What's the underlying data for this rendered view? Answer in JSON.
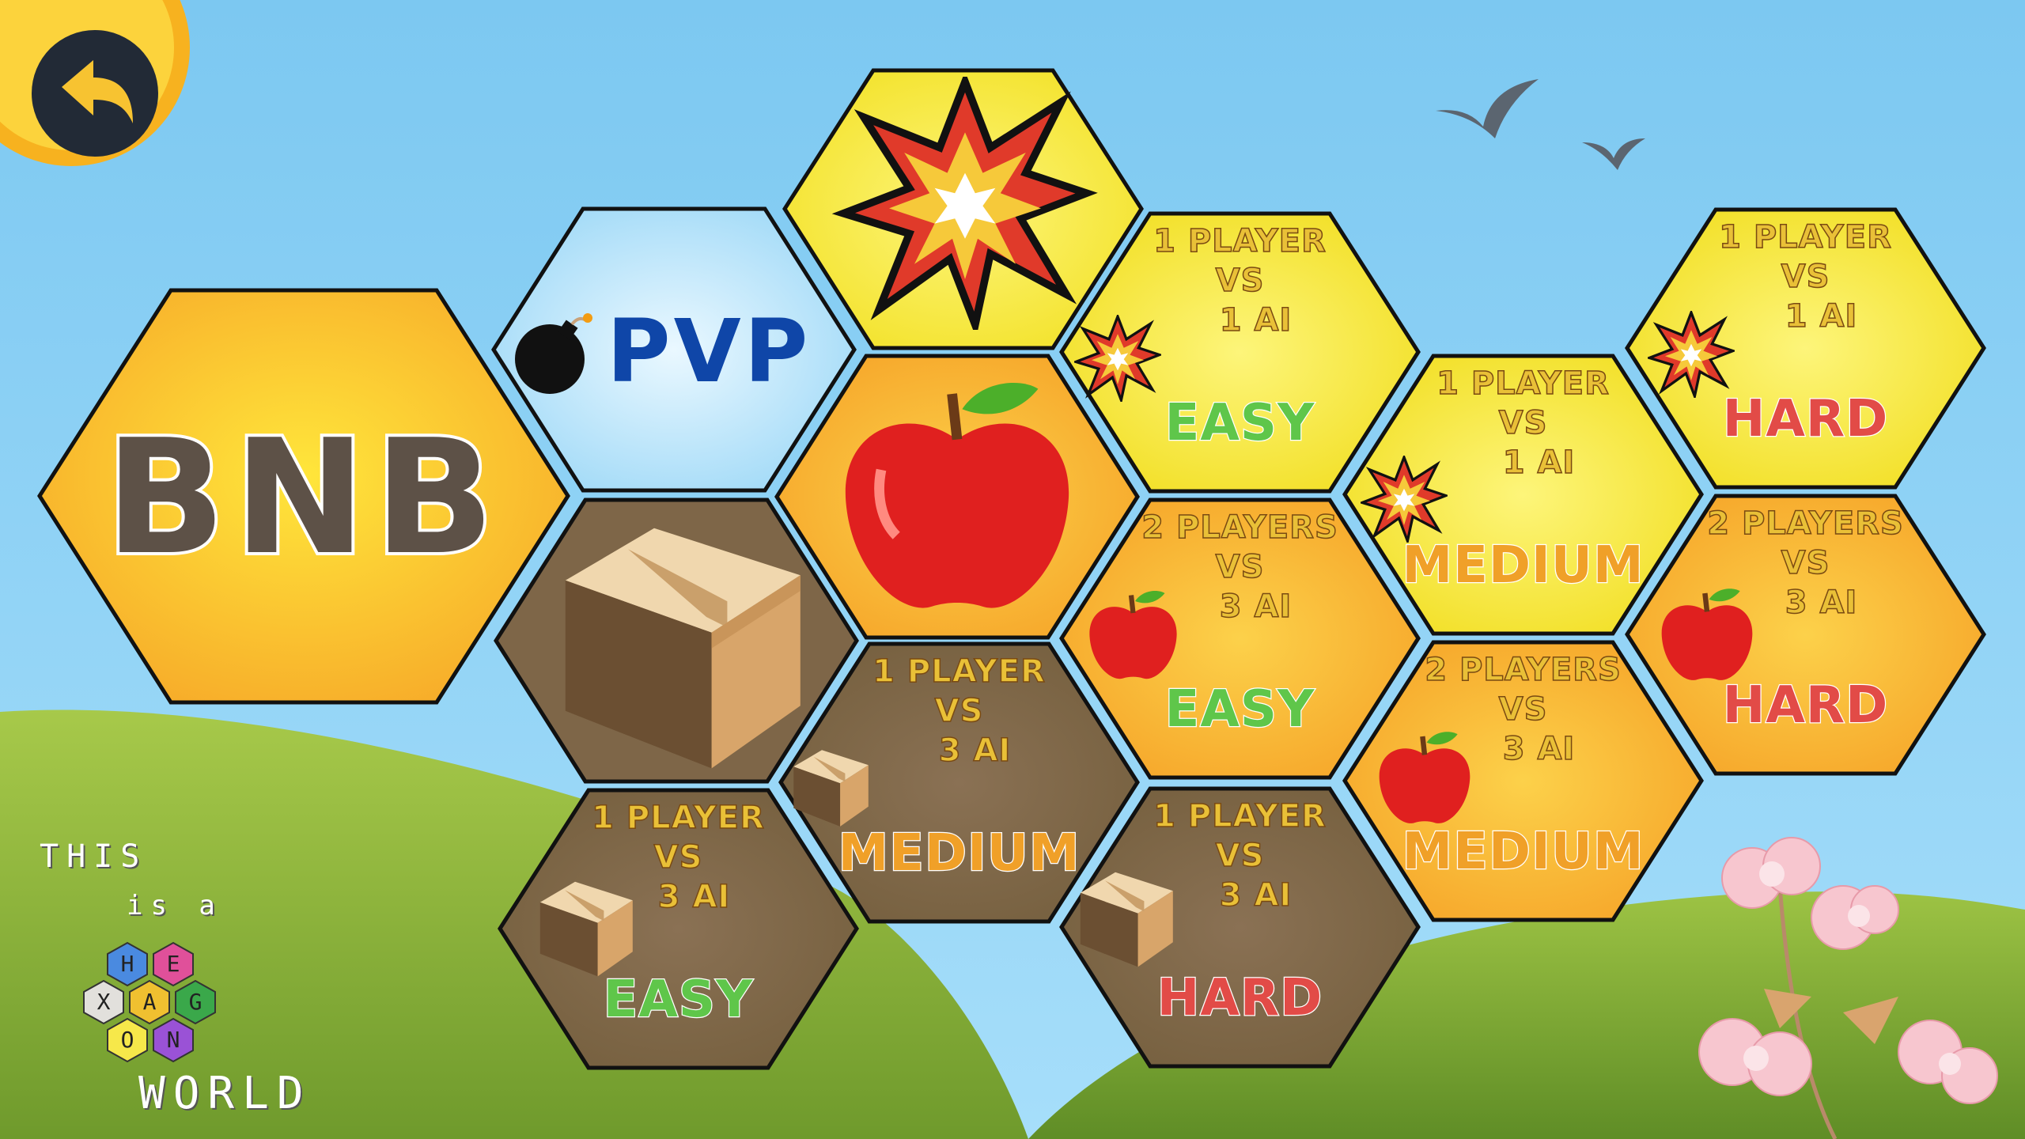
{
  "back_button": {
    "icon": "back-arrow-icon"
  },
  "title_tile": {
    "text": "BNB"
  },
  "pvp_tile": {
    "icon": "bomb-icon",
    "text": "PVP"
  },
  "category_tiles": [
    {
      "name": "explosion-category-tile",
      "icon": "explosion-icon"
    },
    {
      "name": "apple-category-tile",
      "icon": "apple-icon"
    },
    {
      "name": "box-category-tile",
      "icon": "box-icon"
    }
  ],
  "mode_tiles": [
    {
      "id": "explosion-1p-1ai-easy",
      "lines": [
        "1 PLAYER",
        "VS",
        "1 AI"
      ],
      "difficulty": "EASY",
      "icon": "explosion-icon"
    },
    {
      "id": "explosion-1p-1ai-medium",
      "lines": [
        "1 PLAYER",
        "VS",
        "1 AI"
      ],
      "difficulty": "MEDIUM",
      "icon": "explosion-icon"
    },
    {
      "id": "explosion-1p-1ai-hard",
      "lines": [
        "1 PLAYER",
        "VS",
        "1 AI"
      ],
      "difficulty": "HARD",
      "icon": "explosion-icon"
    },
    {
      "id": "apple-2p-3ai-easy",
      "lines": [
        "2 PLAYERS",
        "VS",
        "3 AI"
      ],
      "difficulty": "EASY",
      "icon": "apple-icon"
    },
    {
      "id": "apple-2p-3ai-medium",
      "lines": [
        "2 PLAYERS",
        "VS",
        "3 AI"
      ],
      "difficulty": "MEDIUM",
      "icon": "apple-icon"
    },
    {
      "id": "apple-2p-3ai-hard",
      "lines": [
        "2 PLAYERS",
        "VS",
        "3 AI"
      ],
      "difficulty": "HARD",
      "icon": "apple-icon"
    },
    {
      "id": "box-1p-3ai-easy",
      "lines": [
        "1 PLAYER",
        "VS",
        "3 AI"
      ],
      "difficulty": "EASY",
      "icon": "box-icon"
    },
    {
      "id": "box-1p-3ai-medium",
      "lines": [
        "1 PLAYER",
        "VS",
        "3 AI"
      ],
      "difficulty": "MEDIUM",
      "icon": "box-icon"
    },
    {
      "id": "box-1p-3ai-hard",
      "lines": [
        "1 PLAYER",
        "VS",
        "3 AI"
      ],
      "difficulty": "HARD",
      "icon": "box-icon"
    }
  ],
  "brand": {
    "line1": "THIS",
    "line2": "is a",
    "hex_letters": [
      "H",
      "E",
      "X",
      "A",
      "G",
      "O",
      "N"
    ],
    "line3": "WORLD"
  },
  "colors": {
    "sky": "#8fd3f5",
    "grass": "#8dbb3a",
    "yellow_tile": "#f6ea3a",
    "orange_tile": "#f9b93a",
    "brown_tile": "#7e6648",
    "pvp_tile": "#cfeefc",
    "easy": "#5fc64a",
    "medium": "#f0a028",
    "hard": "#e24b47"
  }
}
